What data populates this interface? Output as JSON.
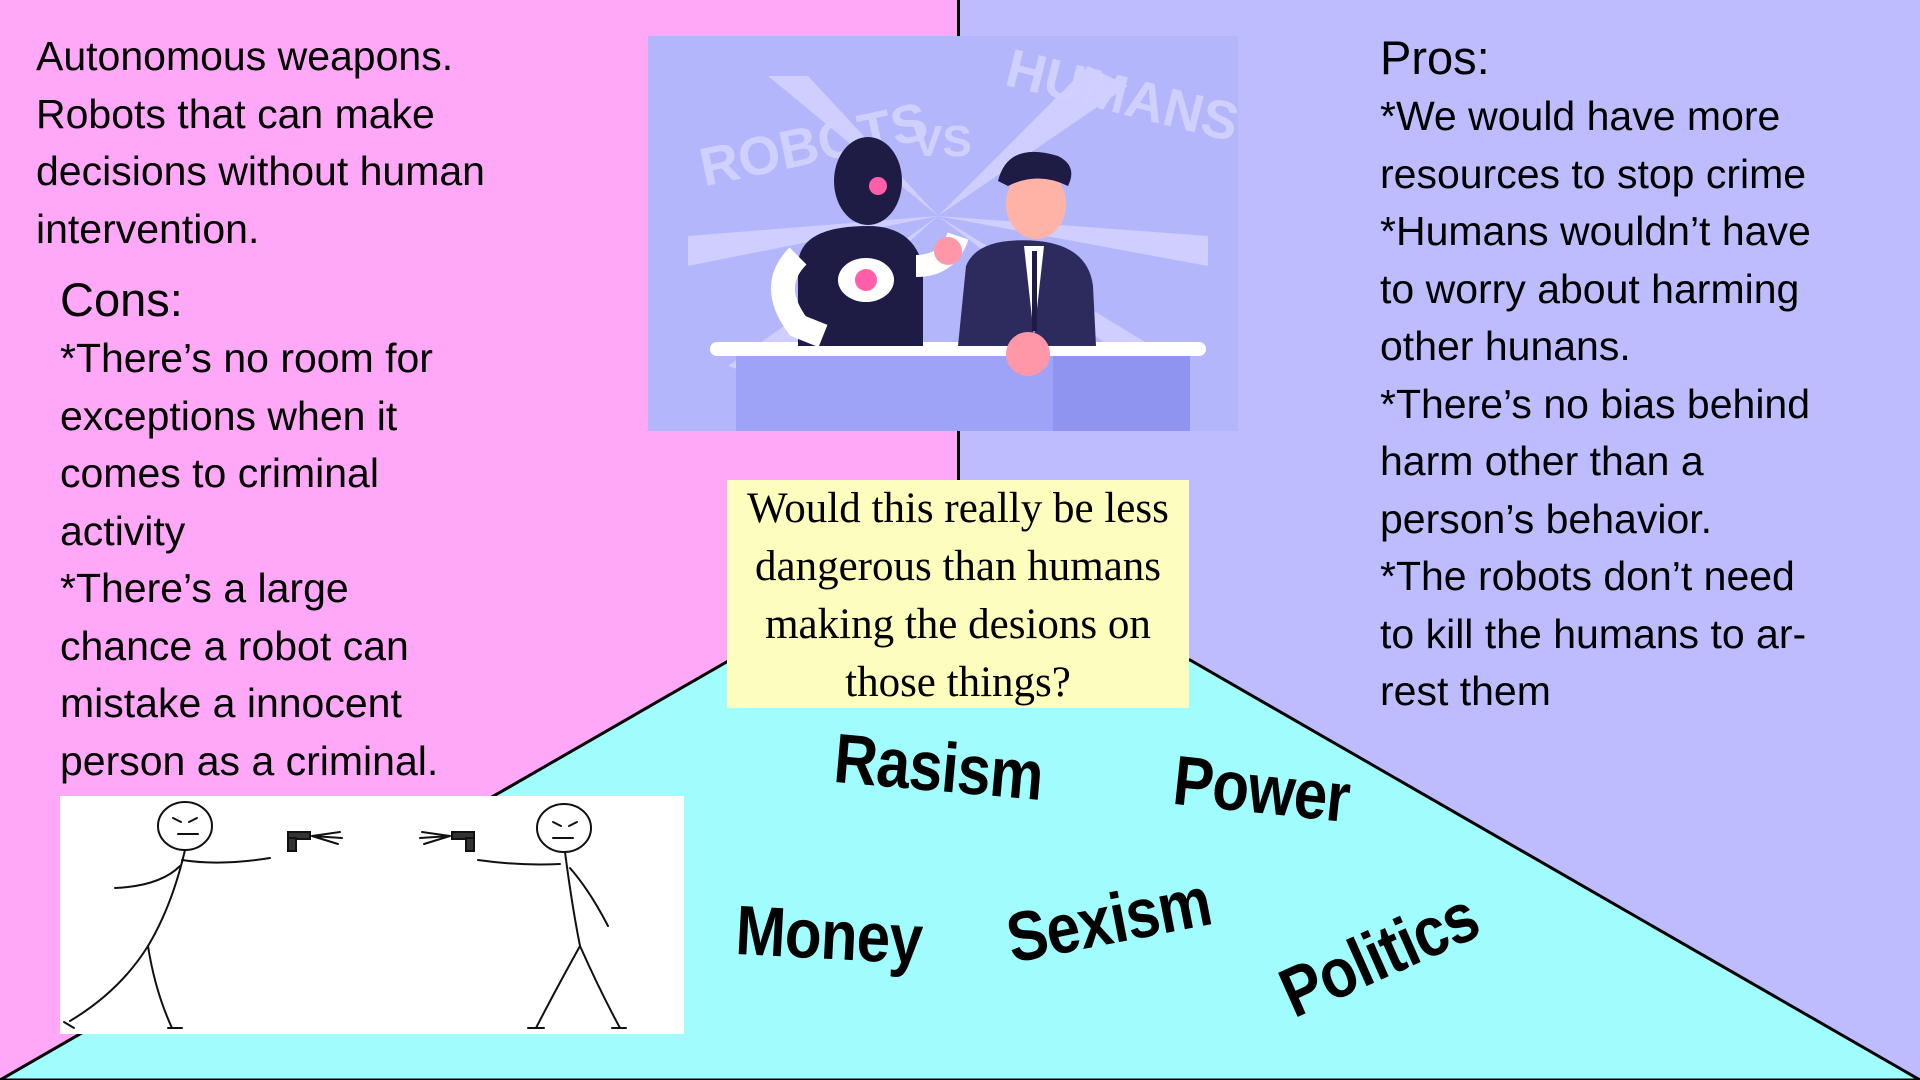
{
  "slide": {
    "intro_lines": [
      "Autonomous weapons.",
      "Robots that can make",
      "decisions without human",
      "intervention."
    ],
    "cons": {
      "heading": "Cons:",
      "lines": [
        "*There’s no room for",
        "exceptions when it",
        "comes to criminal",
        "activity",
        "*There’s a large",
        "chance a robot can",
        "mistake a innocent",
        "person as a criminal."
      ]
    },
    "pros": {
      "heading": "Pros:",
      "lines": [
        "*We would have more",
        "resources to stop crime",
        "*Humans wouldn’t have",
        "to worry about harming",
        "other hunans.",
        "*There’s no bias behind",
        "harm other than a",
        "person’s behavior.",
        "*The robots don’t need",
        "to kill the humans to ar-",
        "rest them"
      ]
    },
    "question_lines": [
      "Would this really be less",
      "dangerous than humans",
      "making the desions on",
      "those things?"
    ],
    "words": {
      "rasism": "Rasism",
      "power": "Power",
      "money": "Money",
      "sexism": "Sexism",
      "politics": "Politics"
    },
    "illustration_text": {
      "left": "ROBOTS",
      "vs": "VS",
      "right": "HUMANS"
    }
  },
  "colors": {
    "left_panel": "#ffa8f7",
    "right_panel": "#bdbcff",
    "bottom_panel": "#a0fcfd",
    "question_box": "#fdfdbd"
  },
  "icons": [
    "robot-vs-human-illustration",
    "stick-figure-duel-illustration"
  ]
}
